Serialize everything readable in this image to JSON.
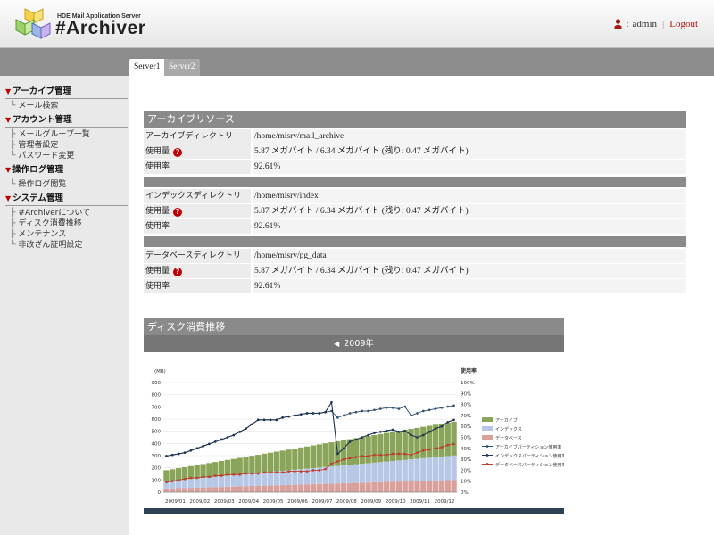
{
  "header": {
    "subtitle": "HDE Mail Application Server",
    "title": "#Archiver",
    "username": "admin",
    "logout": "Logout",
    "logo_icon": "cubes-logo-icon",
    "user_icon": "user-icon"
  },
  "tabs": [
    {
      "label": "Server1",
      "active": true
    },
    {
      "label": "Server2",
      "active": false
    }
  ],
  "sidebar": {
    "sections": [
      {
        "title": "アーカイブ管理",
        "items": [
          "メール検索"
        ]
      },
      {
        "title": "アカウント管理",
        "items": [
          "メールグループ一覧",
          "管理者設定",
          "パスワード変更"
        ]
      },
      {
        "title": "操作ログ管理",
        "items": [
          "操作ログ閲覧"
        ]
      },
      {
        "title": "システム管理",
        "items": [
          "#Archiverについて",
          "ディスク消費推移",
          "メンテナンス",
          "非改ざん証明設定"
        ]
      }
    ]
  },
  "resources": {
    "title": "アーカイブリソース",
    "groups": [
      {
        "dir_label": "アーカイブディレクトリ",
        "dir": "/home/misrv/mail_archive",
        "usage_label": "使用量",
        "usage": "5.87 メガバイト / 6.34 メガバイト (残り: 0.47 メガバイト)",
        "rate_label": "使用率",
        "rate": "92.61%"
      },
      {
        "dir_label": "インデックスディレクトリ",
        "dir": "/home/misrv/index",
        "usage_label": "使用量",
        "usage": "5.87 メガバイト / 6.34 メガバイト (残り: 0.47 メガバイト)",
        "rate_label": "使用率",
        "rate": "92.61%"
      },
      {
        "dir_label": "データベースディレクトリ",
        "dir": "/home/misrv/pg_data",
        "usage_label": "使用量",
        "usage": "5.87 メガバイト / 6.34 メガバイト (残り: 0.47 メガバイト)",
        "rate_label": "使用率",
        "rate": "92.61%"
      }
    ]
  },
  "disk_chart": {
    "title": "ディスク消費推移",
    "year": "2009年"
  },
  "colors": {
    "archive": "#8aa55a",
    "index": "#b7c8e6",
    "database": "#d9a09c",
    "archive_rate_line": "#2f4f6f",
    "index_rate_line": "#1f3550",
    "database_rate_line": "#c0392b"
  },
  "chart_data": {
    "type": "area",
    "ylabel_left": "(MB)",
    "ylabel_right": "使用率",
    "ylim_left": [
      0,
      900
    ],
    "yticks_left": [
      "0",
      "100",
      "200",
      "300",
      "400",
      "500",
      "600",
      "700",
      "800",
      "900"
    ],
    "ylim_right": [
      0,
      100
    ],
    "yticks_right": [
      "0%",
      "10%",
      "20%",
      "30%",
      "40%",
      "50%",
      "60%",
      "70%",
      "80%",
      "90%",
      "100%"
    ],
    "x_tick_labels": [
      "2009/01",
      "2009/02",
      "2009/03",
      "2009/04",
      "2009/05",
      "2009/06",
      "2009/07",
      "2009/08",
      "2009/09",
      "2009/10",
      "2009/11",
      "2009/12"
    ],
    "legend_position": "right",
    "series": [
      {
        "name": "アーカイブ",
        "kind": "stacked-area",
        "axis": "left",
        "values": [
          90,
          94,
          98,
          102,
          106,
          110,
          114,
          118,
          122,
          126,
          130,
          134,
          138,
          142,
          146,
          150,
          154,
          158,
          162,
          166,
          170,
          174,
          178,
          182,
          186,
          190,
          194,
          198,
          202,
          206,
          210,
          214,
          218,
          222,
          226,
          230,
          234,
          238,
          242,
          246,
          250,
          254,
          258,
          262,
          266,
          270,
          274,
          278
        ]
      },
      {
        "name": "インデックス",
        "kind": "stacked-area",
        "axis": "left",
        "values": [
          60,
          63,
          66,
          69,
          72,
          75,
          78,
          81,
          84,
          87,
          90,
          93,
          96,
          99,
          102,
          105,
          108,
          111,
          114,
          117,
          120,
          123,
          126,
          129,
          132,
          135,
          138,
          141,
          144,
          147,
          150,
          153,
          156,
          159,
          162,
          165,
          168,
          171,
          174,
          177,
          180,
          183,
          186,
          189,
          192,
          195,
          198,
          201
        ]
      },
      {
        "name": "データベース",
        "kind": "stacked-area",
        "axis": "left",
        "values": [
          30,
          31,
          33,
          34,
          36,
          37,
          39,
          40,
          42,
          43,
          45,
          46,
          48,
          49,
          51,
          52,
          54,
          55,
          57,
          58,
          60,
          61,
          63,
          64,
          66,
          67,
          69,
          70,
          72,
          73,
          75,
          76,
          78,
          79,
          81,
          82,
          84,
          85,
          87,
          88,
          90,
          91,
          93,
          94,
          96,
          97,
          99,
          100
        ]
      },
      {
        "name": "アーカイブパーティション使用率",
        "kind": "line",
        "axis": "right",
        "values": [
          33,
          34,
          35,
          36,
          38,
          40,
          42,
          44,
          46,
          48,
          50,
          52,
          55,
          58,
          62,
          66,
          66,
          66,
          66,
          68,
          69,
          70,
          71,
          72,
          72,
          72,
          73,
          74,
          68,
          70,
          72,
          73,
          74,
          74,
          75,
          76,
          77,
          77,
          76,
          78,
          70,
          72,
          74,
          75,
          76,
          77,
          78,
          79
        ]
      },
      {
        "name": "インデックスパーティション使用率",
        "kind": "line",
        "axis": "right",
        "values": [
          33,
          34,
          35,
          36,
          38,
          40,
          42,
          44,
          46,
          48,
          50,
          52,
          55,
          58,
          62,
          66,
          66,
          66,
          66,
          68,
          69,
          70,
          71,
          72,
          72,
          72,
          73,
          82,
          35,
          40,
          46,
          48,
          50,
          52,
          54,
          55,
          56,
          57,
          55,
          56,
          52,
          50,
          52,
          55,
          58,
          60,
          64,
          66
        ]
      },
      {
        "name": "データベースパーティション使用率",
        "kind": "line",
        "axis": "right",
        "values": [
          9,
          10,
          11,
          12,
          13,
          13,
          14,
          14,
          15,
          15,
          16,
          16,
          16,
          17,
          17,
          17,
          18,
          18,
          18,
          18,
          19,
          19,
          19,
          19,
          20,
          20,
          21,
          26,
          28,
          30,
          31,
          32,
          33,
          33,
          34,
          34,
          34,
          35,
          35,
          35,
          34,
          36,
          38,
          39,
          40,
          41,
          43,
          44
        ]
      }
    ]
  }
}
